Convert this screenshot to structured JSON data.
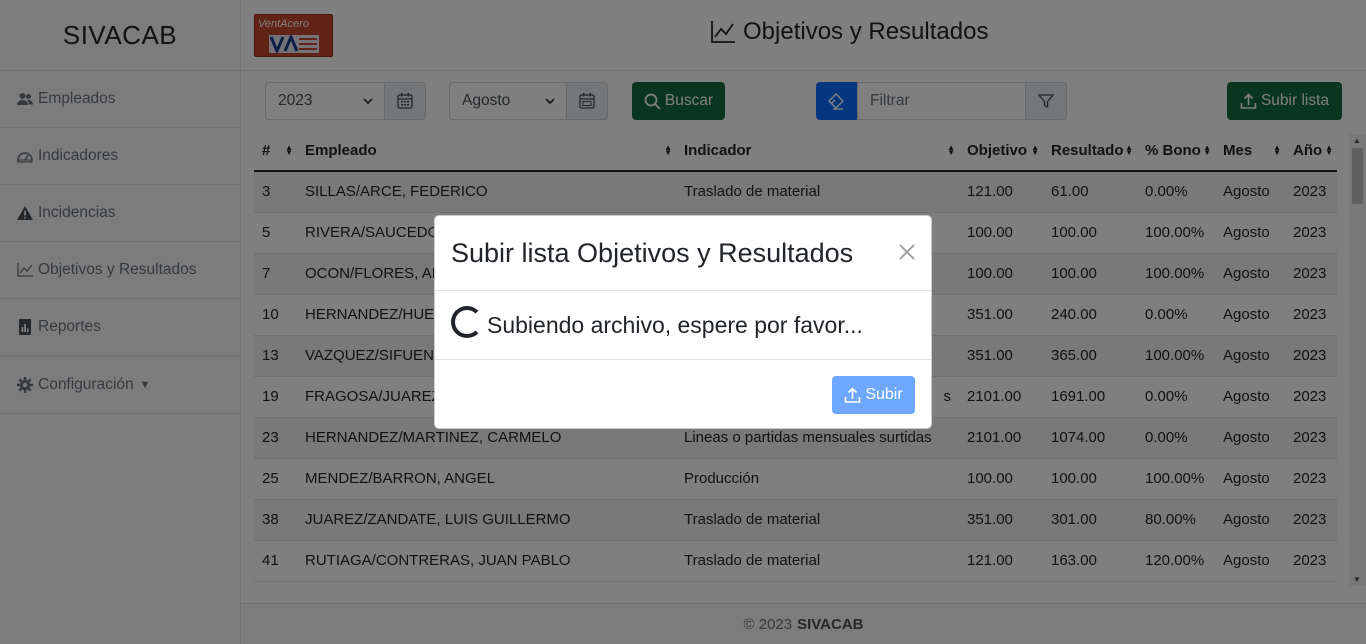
{
  "brand": "SIVACAB",
  "logo_text": "VentAcero",
  "page_title": "Objetivos y Resultados",
  "sidebar": {
    "items": [
      {
        "label": "Empleados",
        "icon": "users-icon"
      },
      {
        "label": "Indicadores",
        "icon": "gauge-icon"
      },
      {
        "label": "Incidencias",
        "icon": "warning-icon"
      },
      {
        "label": "Objetivos y Resultados",
        "icon": "line-chart-icon"
      },
      {
        "label": "Reportes",
        "icon": "report-icon"
      }
    ],
    "config_label": "Configuración"
  },
  "toolbar": {
    "year_value": "2023",
    "month_value": "Agosto",
    "search_label": "Buscar",
    "filter_placeholder": "Filtrar",
    "upload_list_label": "Subir lista"
  },
  "table": {
    "headers": [
      "#",
      "Empleado",
      "Indicador",
      "Objetivo",
      "Resultado",
      "% Bono",
      "Mes",
      "Año"
    ],
    "rows": [
      [
        "3",
        "SILLAS/ARCE, FEDERICO",
        "Traslado de material",
        "121.00",
        "61.00",
        "0.00%",
        "Agosto",
        "2023"
      ],
      [
        "5",
        "RIVERA/SAUCEDO",
        "",
        "100.00",
        "100.00",
        "100.00%",
        "Agosto",
        "2023"
      ],
      [
        "7",
        "OCON/FLORES, AN",
        "",
        "100.00",
        "100.00",
        "100.00%",
        "Agosto",
        "2023"
      ],
      [
        "10",
        "HERNANDEZ/HUE",
        "",
        "351.00",
        "240.00",
        "0.00%",
        "Agosto",
        "2023"
      ],
      [
        "13",
        "VAZQUEZ/SIFUENT",
        "",
        "351.00",
        "365.00",
        "100.00%",
        "Agosto",
        "2023"
      ],
      [
        "19",
        "FRAGOSA/JUAREZ",
        "s",
        "2101.00",
        "1691.00",
        "0.00%",
        "Agosto",
        "2023"
      ],
      [
        "23",
        "HERNANDEZ/MARTINEZ, CARMELO",
        "Lineas o partidas mensuales surtidas",
        "2101.00",
        "1074.00",
        "0.00%",
        "Agosto",
        "2023"
      ],
      [
        "25",
        "MENDEZ/BARRON, ANGEL",
        "Producción",
        "100.00",
        "100.00",
        "100.00%",
        "Agosto",
        "2023"
      ],
      [
        "38",
        "JUAREZ/ZANDATE, LUIS GUILLERMO",
        "Traslado de material",
        "351.00",
        "301.00",
        "80.00%",
        "Agosto",
        "2023"
      ],
      [
        "41",
        "RUTIAGA/CONTRERAS, JUAN PABLO",
        "Traslado de material",
        "121.00",
        "163.00",
        "120.00%",
        "Agosto",
        "2023"
      ]
    ]
  },
  "footer": {
    "copyright": "© 2023",
    "brand": "SIVACAB"
  },
  "modal": {
    "title": "Subir lista Objetivos y Resultados",
    "message": "Subiendo archivo, espere por favor...",
    "upload_button": "Subir"
  },
  "colors": {
    "green": "#146c43",
    "blue": "#0d6efd",
    "upload_disabled": "#6ea8fe"
  }
}
